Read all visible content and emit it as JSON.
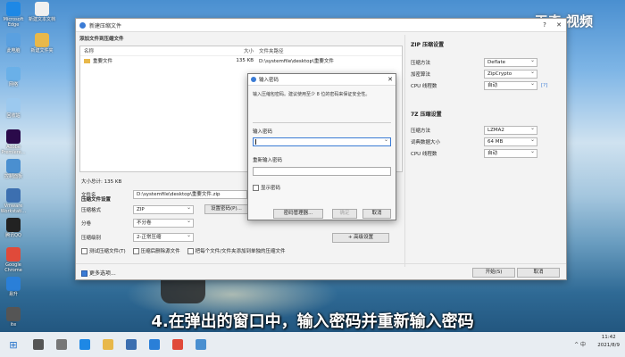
{
  "watermark": "天奇 视频",
  "desktop_icons": [
    {
      "label": "Microsoft Edge",
      "color": "#1e88e5"
    },
    {
      "label": "此电脑",
      "color": "#5aa0e0"
    },
    {
      "label": "网络",
      "color": "#6ab0e8"
    },
    {
      "label": "回收站",
      "color": "#9cc9ef"
    },
    {
      "label": "Adobe Premiere...",
      "color": "#2a0a4a"
    },
    {
      "label": "控制面板",
      "color": "#4a8fd0"
    },
    {
      "label": "Vmware Workstati...",
      "color": "#3c6fb0"
    },
    {
      "label": "腾讯QQ",
      "color": "#222222"
    },
    {
      "label": "Google Chrome",
      "color": "#e04a3a"
    },
    {
      "label": "易升",
      "color": "#2a7fd8"
    },
    {
      "label": "ite",
      "color": "#555555"
    }
  ],
  "desktop_icons_right": [
    {
      "label": "新建文本文档",
      "color": "#f0f0f0"
    },
    {
      "label": "新建文件夹",
      "color": "#e8b84a"
    }
  ],
  "window": {
    "title": "新建压缩文件",
    "add_section": "添加文件到压缩文件",
    "columns": [
      "名称",
      "大小",
      "文件夹路径"
    ],
    "files": [
      {
        "name": "重要文件",
        "size": "135 KB",
        "path": "D:\\systemfile\\desktop\\重要文件"
      }
    ],
    "total": "大小总计: 135 KB",
    "settings_title": "压缩文件设置",
    "filename_label": "文件名",
    "filename_value": "D:\\systemfile\\desktop\\重要文件.zip",
    "format_label": "压缩格式",
    "format_value": "ZIP",
    "set_password_button": "设置密码(P)...",
    "split_label": "分卷",
    "split_value": "不分卷",
    "level_label": "压缩级别",
    "level_value": "2-正常压缩",
    "advanced_button": "+ 高级设置",
    "check_test": "测试压缩文件(T)",
    "check_delete": "压缩后删除源文件",
    "check_separate": "把每个文件/文件夹添加到单独的压缩文件",
    "more_options": "更多选项...",
    "start_button": "开始(S)",
    "cancel_button": "取消",
    "zip_title": "ZIP 压缩设置",
    "zip_method_label": "压缩方法",
    "zip_method_value": "Deflate",
    "zip_encrypt_label": "加密算法",
    "zip_encrypt_value": "ZipCrypto",
    "zip_cpu_label": "CPU 线程数",
    "zip_cpu_value": "自动",
    "zip_help": "[?]",
    "sevenz_title": "7Z 压缩设置",
    "sevenz_method_label": "压缩方法",
    "sevenz_method_value": "LZMA2",
    "sevenz_dict_label": "词典数据大小",
    "sevenz_dict_value": "64 MB",
    "sevenz_cpu_label": "CPU 线程数",
    "sevenz_cpu_value": "自动"
  },
  "dialog": {
    "title": "输入密码",
    "hint": "输入压缩包密码。建议使用至少 8 位的密码来保证安全性。",
    "password_label": "输入密码",
    "password_value": "",
    "repeat_label": "重新输入密码",
    "repeat_value": "",
    "show_password": "显示密码",
    "manager_button": "密码管理器...",
    "ok_button": "确定",
    "cancel_button": "取消"
  },
  "subtitle": "4.在弹出的窗口中，输入密码并重新输入密码",
  "taskbar": {
    "time": "11:42",
    "date": "2021/8/9",
    "tray": "^ 中",
    "apps": [
      {
        "name": "search",
        "color": "#555555"
      },
      {
        "name": "task-view",
        "color": "#777777"
      },
      {
        "name": "edge",
        "color": "#1e88e5"
      },
      {
        "name": "explorer",
        "color": "#e8b84a"
      },
      {
        "name": "store",
        "color": "#3c6fb0"
      },
      {
        "name": "mail",
        "color": "#2a7fd8"
      },
      {
        "name": "chrome",
        "color": "#e04a3a"
      },
      {
        "name": "bandizip",
        "color": "#4a8fd0"
      }
    ]
  }
}
